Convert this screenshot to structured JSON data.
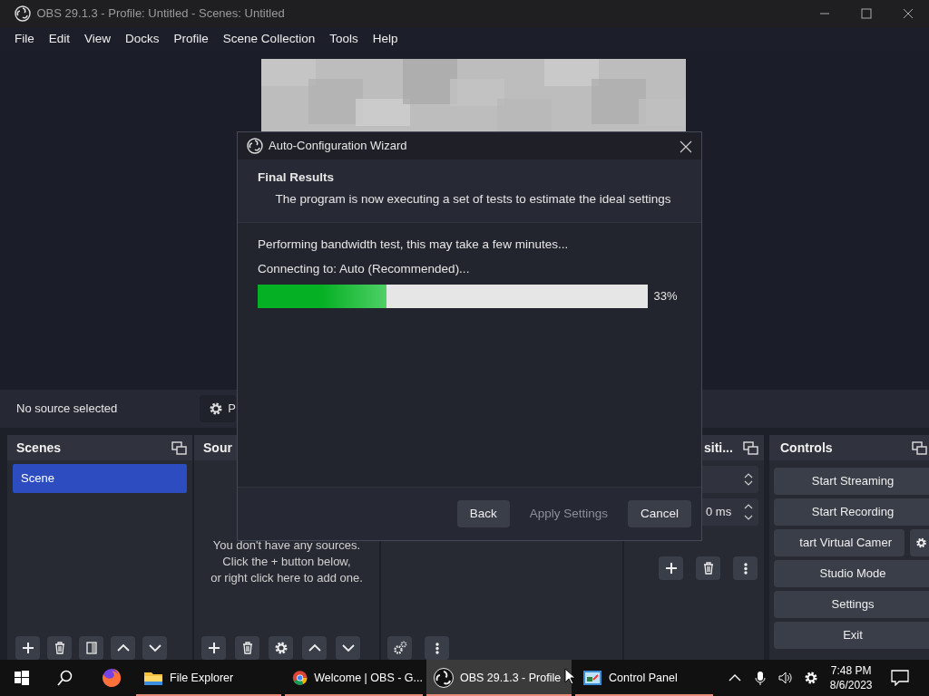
{
  "window": {
    "title": "OBS 29.1.3 - Profile: Untitled - Scenes: Untitled"
  },
  "menu": [
    "File",
    "Edit",
    "View",
    "Docks",
    "Profile",
    "Scene Collection",
    "Tools",
    "Help"
  ],
  "source_bar": {
    "label": "No source selected",
    "properties_button": "P"
  },
  "scenes": {
    "title": "Scenes",
    "items": [
      {
        "label": "Scene",
        "selected": true
      }
    ]
  },
  "sources": {
    "title": "Sour",
    "empty_message": [
      "You don't have any sources.",
      "Click the + button below,",
      "or right click here to add one."
    ]
  },
  "transitions": {
    "title": "siti...",
    "duration": "0 ms"
  },
  "controls": {
    "title": "Controls",
    "buttons": [
      {
        "label": "Start Streaming",
        "kind": "plain"
      },
      {
        "label": "Start Recording",
        "kind": "plain"
      },
      {
        "label": "tart Virtual Camer",
        "kind": "split"
      },
      {
        "label": "Studio Mode",
        "kind": "plain"
      },
      {
        "label": "Settings",
        "kind": "plain"
      },
      {
        "label": "Exit",
        "kind": "plain"
      }
    ]
  },
  "dialog": {
    "title": "Auto-Configuration Wizard",
    "heading": "Final Results",
    "subheading": "The program is now executing a set of tests to estimate the ideal settings",
    "status": [
      "Performing bandwidth test, this may take a few minutes...",
      "Connecting to: Auto (Recommended)..."
    ],
    "progress": {
      "level": 0.33,
      "reading": "33%"
    },
    "buttons": [
      {
        "label": "Back",
        "disabled": false
      },
      {
        "label": "Apply Settings",
        "disabled": true
      },
      {
        "label": "Cancel",
        "disabled": false
      }
    ]
  },
  "taskbar": {
    "apps": [
      {
        "kind": "firefox",
        "running": false,
        "active": false
      },
      {
        "kind": "folder",
        "label": "File Explorer",
        "running": true,
        "active": false
      },
      {
        "kind": "chrome",
        "label": "Welcome | OBS - G...",
        "running": true,
        "active": false
      },
      {
        "kind": "obs",
        "label": "OBS 29.1.3 - Profile",
        "running": true,
        "active": true
      },
      {
        "kind": "control-panel",
        "label": "Control Panel",
        "running": true,
        "active": false
      }
    ],
    "time": "7:48 PM",
    "date": "8/6/2023"
  }
}
